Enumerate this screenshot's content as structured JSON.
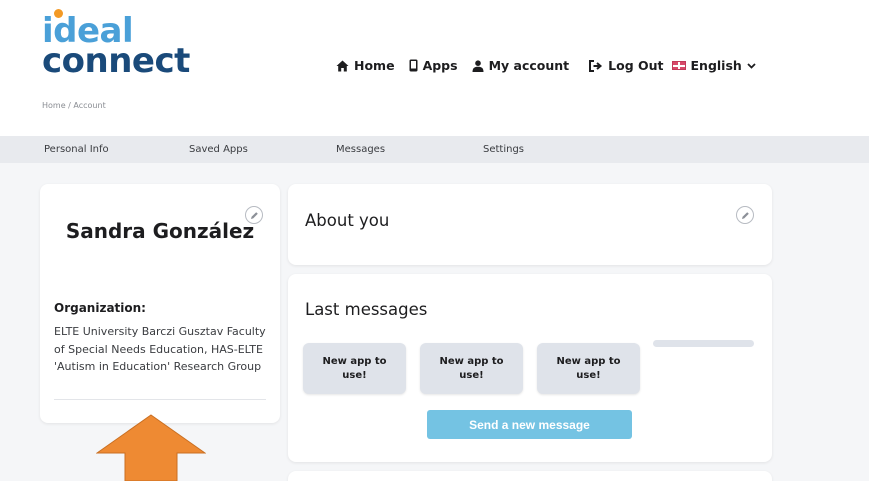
{
  "brand": {
    "line1": "ideal",
    "line2": "connect"
  },
  "nav": {
    "home": "Home",
    "apps": "Apps",
    "account": "My account",
    "logout": "Log Out",
    "language": "English"
  },
  "breadcrumb": "Home / Account",
  "tabs": [
    "Personal Info",
    "Saved Apps",
    "Messages",
    "Settings"
  ],
  "profile": {
    "name": "Sandra González",
    "org_label": "Organization:",
    "org_text": "ELTE University Barczi Gusztav Faculty of Special Needs Education, HAS-ELTE 'Autism in Education' Research Group"
  },
  "about": {
    "title": "About you"
  },
  "messages": {
    "title": "Last messages",
    "items": [
      "New app to use!",
      "New app to use!",
      "New app to use!"
    ],
    "send_label": "Send a new message"
  },
  "colors": {
    "accent": "#74c3e3",
    "arrow": "#ee8a33",
    "brand_light": "#4aa0d8",
    "brand_dark": "#1a4a7a"
  }
}
